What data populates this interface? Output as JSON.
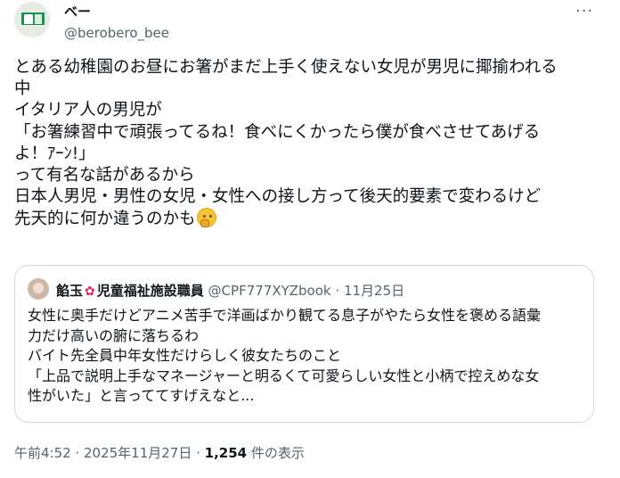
{
  "author": {
    "display_name": "ベー",
    "handle": "@berobero_bee",
    "avatar_icon": "emergency-exit-sign"
  },
  "more_icon_label": "···",
  "tweet_lines": [
    "とある幼稚園のお昼にお箸がまだ上手く使えない女児が男児に揶揄われる",
    "中",
    "イタリア人の男児が",
    "「お箸練習中で頑張ってるね！食べにくかったら僕が食べさせてあげる",
    "よ！ｱｰﾝ!」",
    "って有名な話があるから",
    "日本人男児・男性の女児・女性への接し方って後天的要素で変わるけど",
    "先天的に何か違うのかも"
  ],
  "trailing_emoji": "thinking-face",
  "quote": {
    "name": "餡玉",
    "name_suffix": "児童福祉施設職員",
    "handle": "@CPF777XYZbook",
    "separator": "·",
    "date": "11月25日",
    "lines": [
      "女性に奥手だけどアニメ苦手で洋画ばかり観てる息子がやたら女性を褒める語彙",
      "力だけ高いの腑に落ちるわ",
      "バイト先全員中年女性だけらしく彼女たちのこと",
      "「上品で説明上手なマネージャーと明るくて可愛らしい女性と小柄で控えめな女",
      "性がいた」と言っててすげえなと..."
    ]
  },
  "meta": {
    "time_date": "午前4:52 · 2025年11月27日 · ",
    "views_count": "1,254",
    "views_label": " 件の表示"
  },
  "colors": {
    "text": "#0f1419",
    "secondary": "#536471",
    "border": "#cfd9de"
  }
}
